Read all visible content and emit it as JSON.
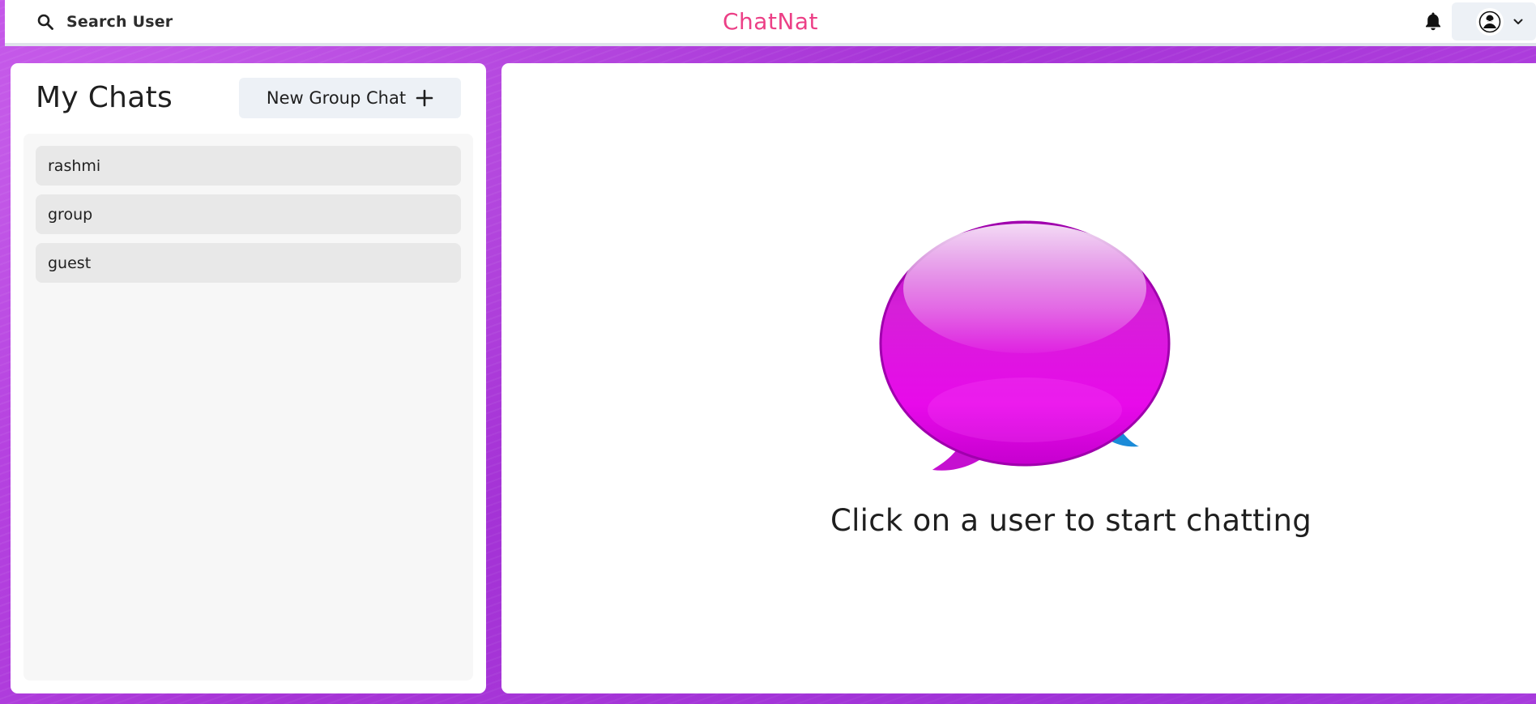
{
  "header": {
    "search_label": "Search User",
    "brand": "ChatNat",
    "brand_color": "#ec3f86",
    "icons": {
      "search": "search-icon",
      "notifications": "bell-icon",
      "avatar": "avatar-image",
      "menu": "chevron-down-icon"
    }
  },
  "sidebar": {
    "title": "My Chats",
    "new_group_label": "New Group Chat",
    "new_group_icon": "plus-icon",
    "chats": [
      {
        "name": "rashmi"
      },
      {
        "name": "group"
      },
      {
        "name": "guest"
      }
    ]
  },
  "main": {
    "empty_message": "Click on a user to start chatting",
    "illustration": "chat-bubbles-illustration"
  },
  "colors": {
    "background": "#b83fe0",
    "panel": "#ffffff",
    "list_bg": "#f7f7f7",
    "chat_item_bg": "#e8e8e8",
    "button_bg": "#edf1f6",
    "bubble_magenta": "#d40fd8",
    "bubble_blue": "#2aa2ea"
  }
}
